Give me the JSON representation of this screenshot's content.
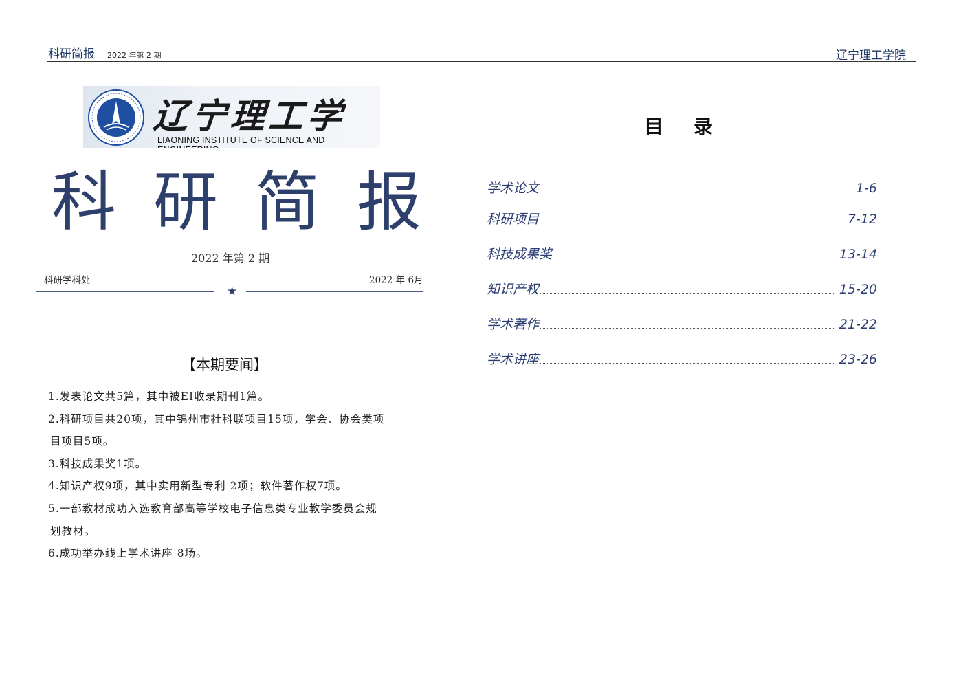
{
  "running_header": {
    "title": "科研简报",
    "issue": "2022 年第 2 期",
    "institution": "辽宁理工学院"
  },
  "logo": {
    "name_cn": "辽宁理工学院",
    "name_en": "LIAONING INSTITUTE OF SCIENCE AND ENGINEERING",
    "emblem_top_text": "辽宁理工学院",
    "emblem_ring_text": "Liaoning Institute of Science and Engineering",
    "emblem_color": "#1e4fa0"
  },
  "masthead": {
    "title": "科研简报",
    "issue": "2022 年第 2 期",
    "department": "科研学科处",
    "date": "2022 年 6月",
    "star": "★",
    "color": "#2d3f6b"
  },
  "highlights": {
    "title": "【本期要闻】",
    "items": [
      "1.发表论文共5篇，其中被EI收录期刊1篇。",
      "2.科研项目共20项，其中锦州市社科联项目15项，学会、协会类项",
      "目项目5项。",
      "3.科技成果奖1项。",
      "4.知识产权9项，其中实用新型专利 2项；软件著作权7项。",
      "5.一部教材成功入选教育部高等学校电子信息类专业教学委员会规",
      "划教材。",
      "6.成功举办线上学术讲座 8场。"
    ]
  },
  "toc": {
    "title": "目录",
    "entries": [
      {
        "label": "学术论文",
        "pages": "1-6"
      },
      {
        "label": "科研项目",
        "pages": "7-12"
      },
      {
        "label": "科技成果奖",
        "pages": "13-14"
      },
      {
        "label": "知识产权",
        "pages": "15-20"
      },
      {
        "label": "学术著作",
        "pages": "21-22"
      },
      {
        "label": "学术讲座",
        "pages": "23-26"
      }
    ],
    "accent_color": "#2b3d73"
  }
}
